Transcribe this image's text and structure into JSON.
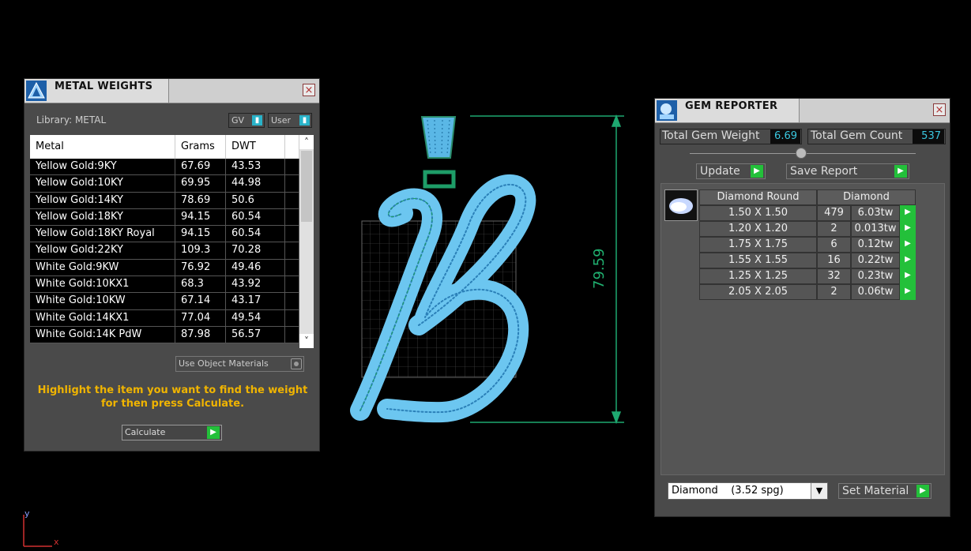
{
  "metal_weights": {
    "title": "METAL WEIGHTS",
    "library_label": "Library: METAL",
    "toggle_gv": "GV",
    "toggle_user": "User",
    "columns": [
      "Metal",
      "Grams",
      "DWT"
    ],
    "rows": [
      [
        "Yellow Gold:9KY",
        "67.69",
        "43.53"
      ],
      [
        "Yellow Gold:10KY",
        "69.95",
        "44.98"
      ],
      [
        "Yellow Gold:14KY",
        "78.69",
        "50.6"
      ],
      [
        "Yellow Gold:18KY",
        "94.15",
        "60.54"
      ],
      [
        "Yellow Gold:18KY Royal",
        "94.15",
        "60.54"
      ],
      [
        "Yellow Gold:22KY",
        "109.3",
        "70.28"
      ],
      [
        "White Gold:9KW",
        "76.92",
        "49.46"
      ],
      [
        "White Gold:10KX1",
        "68.3",
        "43.92"
      ],
      [
        "White Gold:10KW",
        "67.14",
        "43.17"
      ],
      [
        "White Gold:14KX1",
        "77.04",
        "49.54"
      ],
      [
        "White Gold:14K PdW",
        "87.98",
        "56.57"
      ]
    ],
    "use_object_materials": "Use Object Materials",
    "hint": "Highlight the item you want to find the weight for then press Calculate.",
    "calculate_label": "Calculate"
  },
  "viewport": {
    "dimension_label": "79.59",
    "axis_y": "y",
    "axis_x": "x"
  },
  "gem_reporter": {
    "title": "GEM REPORTER",
    "total_weight_label": "Total Gem Weight",
    "total_weight_value": "6.69",
    "total_count_label": "Total Gem Count",
    "total_count_value": "537",
    "update_label": "Update",
    "save_report_label": "Save Report",
    "table_head": [
      "Diamond Round",
      "Diamond"
    ],
    "rows": [
      [
        "1.50 X 1.50",
        "479",
        "6.03tw"
      ],
      [
        "1.20 X 1.20",
        "2",
        "0.013tw"
      ],
      [
        "1.75 X 1.75",
        "6",
        "0.12tw"
      ],
      [
        "1.55 X 1.55",
        "16",
        "0.22tw"
      ],
      [
        "1.25 X 1.25",
        "32",
        "0.23tw"
      ],
      [
        "2.05 X 2.05",
        "2",
        "0.06tw"
      ]
    ],
    "material_select": "Diamond    (3.52 spg)",
    "set_material_label": "Set Material"
  },
  "colors": {
    "accent": "#29b3c9",
    "green_button": "#23c03a",
    "hint_text": "#f0b400",
    "dimension": "#20b070"
  }
}
